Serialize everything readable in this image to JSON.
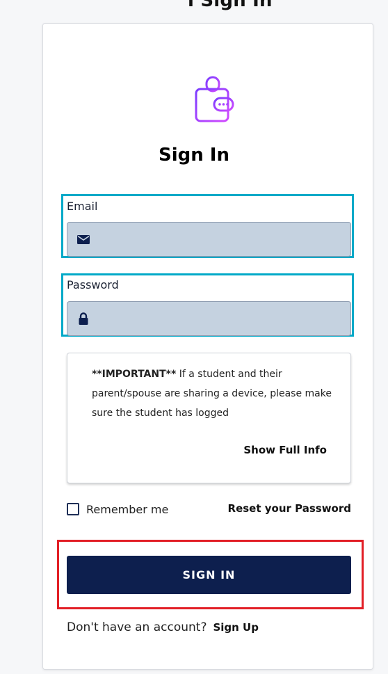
{
  "top_heading_fragment": "ı Sign In",
  "title": "Sign In",
  "email": {
    "label": "Email",
    "value": ""
  },
  "password": {
    "label": "Password",
    "value": ""
  },
  "notice": {
    "bold_prefix": "**IMPORTANT**",
    "text": " If a student and their parent/spouse are sharing a device, please make sure the student has logged",
    "show_full_label": "Show Full Info"
  },
  "remember_label": "Remember me",
  "reset_label": "Reset your Password",
  "signin_label": "SIGN IN",
  "signup_prompt": "Don't have an account?",
  "signup_label": "Sign Up",
  "colors": {
    "primary_button": "#0d1f4e",
    "field_highlight": "#00a9c8",
    "button_highlight": "#e21f26",
    "input_bg": "#c5d2e0",
    "logo_gradient_start": "#7a3cff",
    "logo_gradient_end": "#d24bff"
  },
  "icons": {
    "logo": "wallet-lock-icon",
    "email": "envelope-icon",
    "password": "lock-icon"
  }
}
